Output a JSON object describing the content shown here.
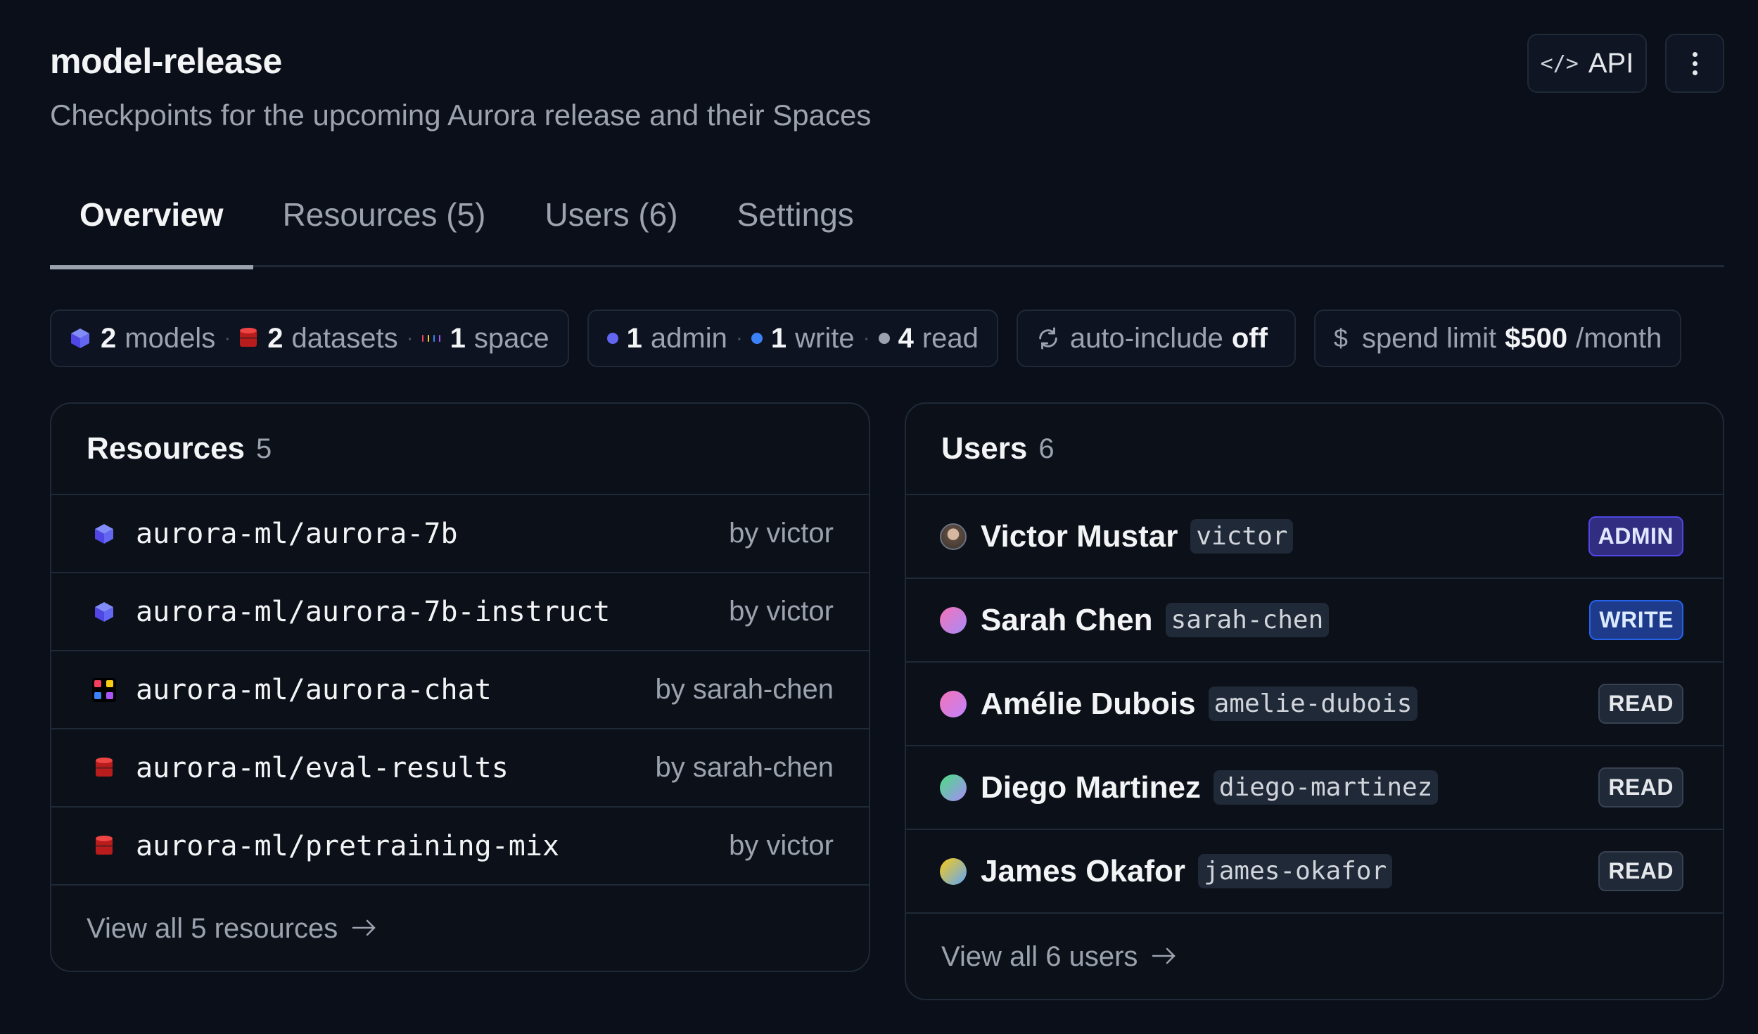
{
  "header": {
    "title": "model-release",
    "subtitle": "Checkpoints for the upcoming Aurora release and their Spaces",
    "api_label": "API"
  },
  "tabs": [
    {
      "label": "Overview",
      "active": true
    },
    {
      "label": "Resources (5)",
      "active": false
    },
    {
      "label": "Users (6)",
      "active": false
    },
    {
      "label": "Settings",
      "active": false
    }
  ],
  "stats": {
    "models_count": "2",
    "models_label": "models",
    "datasets_count": "2",
    "datasets_label": "datasets",
    "spaces_count": "1",
    "spaces_label": "space",
    "admin_count": "1",
    "admin_label": "admin",
    "write_count": "1",
    "write_label": "write",
    "read_count": "4",
    "read_label": "read",
    "auto_include_label": "auto-include",
    "auto_include_value": "off",
    "spend_label": "spend limit",
    "spend_value": "$500",
    "spend_period": "/month"
  },
  "colors": {
    "model": "#6366f1",
    "dataset": "#dc2626",
    "admin_dot": "#6366f1",
    "write_dot": "#3b82f6",
    "read_dot": "#9ca3af"
  },
  "resources": {
    "title": "Resources",
    "count": "5",
    "items": [
      {
        "type": "model",
        "name": "aurora-ml/aurora-7b",
        "by": "by victor"
      },
      {
        "type": "model",
        "name": "aurora-ml/aurora-7b-instruct",
        "by": "by victor"
      },
      {
        "type": "space",
        "name": "aurora-ml/aurora-chat",
        "by": "by sarah-chen"
      },
      {
        "type": "dataset",
        "name": "aurora-ml/eval-results",
        "by": "by sarah-chen"
      },
      {
        "type": "dataset",
        "name": "aurora-ml/pretraining-mix",
        "by": "by victor"
      }
    ],
    "view_all": "View all 5 resources"
  },
  "users": {
    "title": "Users",
    "count": "6",
    "items": [
      {
        "name": "Victor Mustar",
        "handle": "victor",
        "role": "ADMIN"
      },
      {
        "name": "Sarah Chen",
        "handle": "sarah-chen",
        "role": "WRITE"
      },
      {
        "name": "Amélie Dubois",
        "handle": "amelie-dubois",
        "role": "READ"
      },
      {
        "name": "Diego Martinez",
        "handle": "diego-martinez",
        "role": "READ"
      },
      {
        "name": "James Okafor",
        "handle": "james-okafor",
        "role": "READ"
      }
    ],
    "view_all": "View all 6 users"
  }
}
